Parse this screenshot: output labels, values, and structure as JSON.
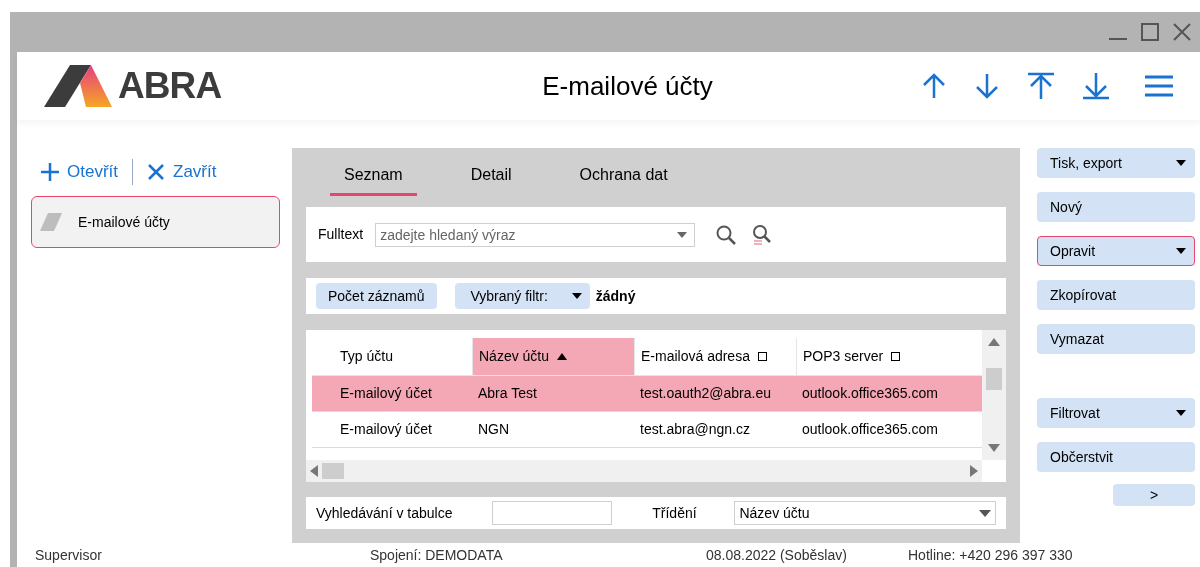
{
  "logo": {
    "text": "ABRA"
  },
  "header": {
    "title": "E-mailové účty"
  },
  "left_panel": {
    "actions": [
      {
        "label": "Otevřít",
        "kind": "open"
      },
      {
        "label": "Zavřít",
        "kind": "close"
      }
    ],
    "items": [
      {
        "label": "E-mailové účty",
        "selected": true
      }
    ]
  },
  "tabs": [
    {
      "label": "Seznam",
      "selected": true
    },
    {
      "label": "Detail",
      "selected": false
    },
    {
      "label": "Ochrana dat",
      "selected": false
    }
  ],
  "fulltext": {
    "label": "Fulltext",
    "placeholder": "zadejte hledaný výraz"
  },
  "filter_bar": {
    "count_button": "Počet záznamů",
    "filter_button": "Vybraný filtr:",
    "filter_value": "žádný"
  },
  "table": {
    "columns": [
      {
        "label": "Typ účtu",
        "kind": "plain"
      },
      {
        "label": "Název účtu",
        "kind": "sorted"
      },
      {
        "label": "E-mailová adresa",
        "kind": "marked"
      },
      {
        "label": "POP3 server",
        "kind": "marked"
      }
    ],
    "rows": [
      {
        "cells": [
          "E-mailový účet",
          "Abra Test",
          "test.oauth2@abra.eu",
          "outlook.office365.com"
        ],
        "selected": true
      },
      {
        "cells": [
          "E-mailový účet",
          "NGN",
          "test.abra@ngn.cz",
          "outlook.office365.com"
        ],
        "selected": false
      }
    ]
  },
  "table_footer": {
    "search_label": "Vyhledávání v tabulce",
    "sort_label": "Třídění",
    "sort_value": "Název účtu"
  },
  "side_buttons": [
    {
      "label": "Tisk, export",
      "dropdown": true,
      "focused": false
    },
    {
      "label": "Nový",
      "dropdown": false,
      "focused": false
    },
    {
      "label": "Opravit",
      "dropdown": true,
      "focused": true
    },
    {
      "label": "Zkopírovat",
      "dropdown": false,
      "focused": false
    },
    {
      "label": "Vymazat",
      "dropdown": false,
      "focused": false
    }
  ],
  "side_buttons_lower": [
    {
      "label": "Filtrovat",
      "dropdown": true,
      "focused": false
    },
    {
      "label": "Občerstvit",
      "dropdown": false,
      "focused": false
    }
  ],
  "more_button": ">",
  "status_bar": [
    "Supervisor",
    "Spojení: DEMODATA",
    "08.08.2022 (Soběslav)",
    "Hotline: +420 296 397 330"
  ]
}
